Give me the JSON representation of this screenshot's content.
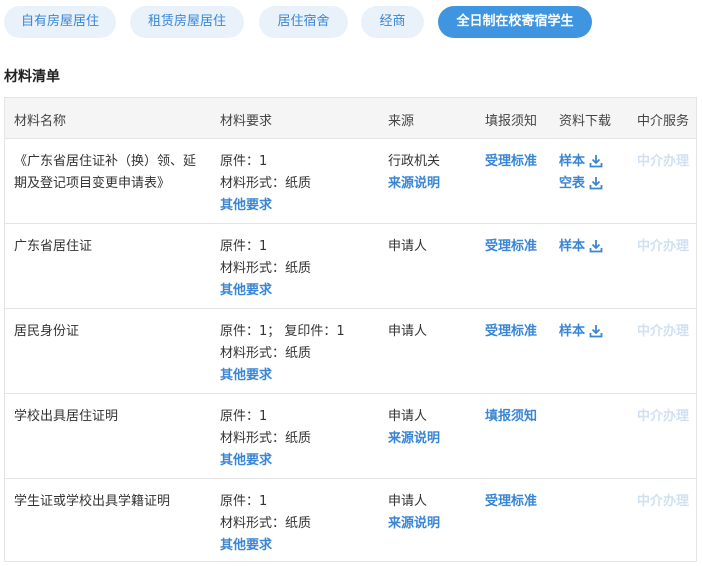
{
  "tabs": [
    "自有房屋居住",
    "租赁房屋居住",
    "居住宿舍",
    "经商",
    "全日制在校寄宿学生"
  ],
  "active_tab": 4,
  "section_title": "材料清单",
  "columns": [
    "材料名称",
    "材料要求",
    "来源",
    "填报须知",
    "资料下载",
    "中介服务"
  ],
  "rows": [
    {
      "name": "《广东省居住证补（换）领、延期及登记项目变更申请表》",
      "req_line1": "原件：1",
      "req_line2": "材料形式：纸质",
      "req_more": "其他要求",
      "source": "行政机关",
      "source_link": "来源说明",
      "notice": "受理标准",
      "downloads": [
        "样本",
        "空表"
      ],
      "agency": "中介办理"
    },
    {
      "name": "广东省居住证",
      "req_line1": "原件：1",
      "req_line2": "材料形式：纸质",
      "req_more": "其他要求",
      "source": "申请人",
      "source_link": "",
      "notice": "受理标准",
      "downloads": [
        "样本"
      ],
      "agency": "中介办理"
    },
    {
      "name": "居民身份证",
      "req_line1": "原件：1； 复印件：1",
      "req_line2": "材料形式：纸质",
      "req_more": "其他要求",
      "source": "申请人",
      "source_link": "",
      "notice": "受理标准",
      "downloads": [
        "样本"
      ],
      "agency": "中介办理"
    },
    {
      "name": "学校出具居住证明",
      "req_line1": "原件：1",
      "req_line2": "材料形式：纸质",
      "req_more": "其他要求",
      "source": "申请人",
      "source_link": "来源说明",
      "notice": "填报须知",
      "downloads": [],
      "agency": "中介办理"
    },
    {
      "name": "学生证或学校出具学籍证明",
      "req_line1": "原件：1",
      "req_line2": "材料形式：纸质",
      "req_more": "其他要求",
      "source": "申请人",
      "source_link": "来源说明",
      "notice": "受理标准",
      "downloads": [],
      "agency": "中介办理"
    }
  ],
  "download_icon": "download-icon"
}
